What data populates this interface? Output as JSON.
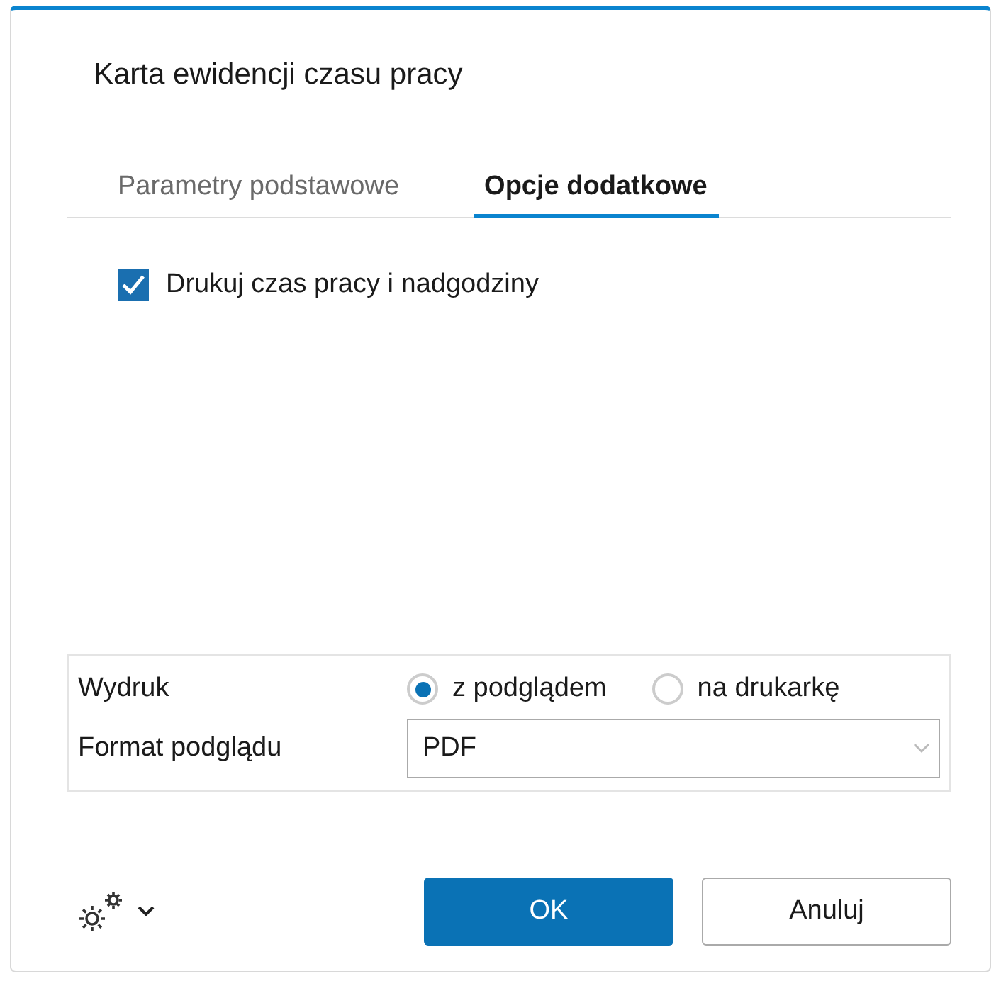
{
  "window": {
    "title": "Karta ewidencji czasu pracy"
  },
  "tabs": [
    {
      "label": "Parametry podstawowe",
      "selected": false
    },
    {
      "label": "Opcje dodatkowe",
      "selected": true
    }
  ],
  "options": [
    {
      "label": "Drukuj czas pracy i nadgodziny",
      "checked": true
    }
  ],
  "print": {
    "label": "Wydruk",
    "choices": [
      {
        "label": "z podglądem",
        "selected": true
      },
      {
        "label": "na drukarkę",
        "selected": false
      }
    ]
  },
  "preview_format": {
    "label": "Format podglądu",
    "value": "PDF"
  },
  "buttons": [
    {
      "label": "OK",
      "kind": "primary"
    },
    {
      "label": "Anuluj",
      "kind": "secondary"
    }
  ]
}
